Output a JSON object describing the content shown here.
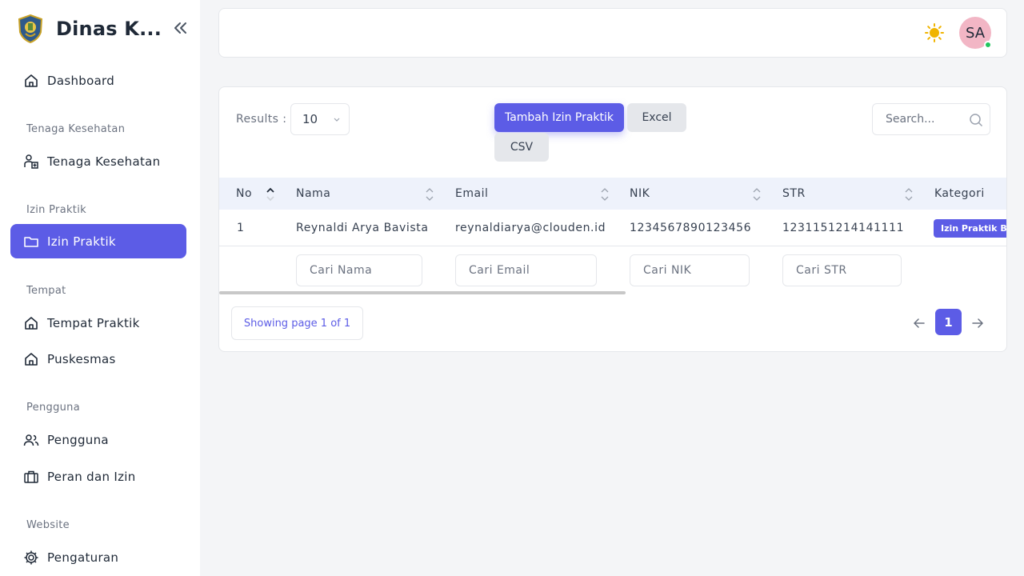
{
  "app": {
    "title": "Dinas K..."
  },
  "sidebar": {
    "sections": {
      "tenaga": "Tenaga Kesehatan",
      "izin": "Izin Praktik",
      "tempat": "Tempat",
      "pengguna": "Pengguna",
      "website": "Website"
    },
    "items": {
      "dashboard": "Dashboard",
      "tenaga": "Tenaga Kesehatan",
      "izin": "Izin Praktik",
      "tempat_praktik": "Tempat Praktik",
      "puskesmas": "Puskesmas",
      "pengguna": "Pengguna",
      "peran": "Peran dan Izin",
      "pengaturan": "Pengaturan"
    },
    "active": "Izin Praktik"
  },
  "header": {
    "avatar_initials": "SA",
    "theme_icon": "sun-icon"
  },
  "toolbar": {
    "results_label": "Results :",
    "page_size": "10",
    "add_label": "Tambah Izin Praktik",
    "excel_label": "Excel",
    "csv_label": "CSV",
    "search_placeholder": "Search..."
  },
  "table": {
    "columns": {
      "no": "No",
      "nama": "Nama",
      "email": "Email",
      "nik": "NIK",
      "str": "STR",
      "kategori": "Kategori"
    },
    "rows": [
      {
        "no": "1",
        "nama": "Reynaldi Arya Bavista",
        "email": "reynaldiarya@clouden.id",
        "nik": "1234567890123456",
        "str": "1231151214141111",
        "kategori": "Izin Praktik B"
      }
    ],
    "filters": {
      "nama": "Cari Nama",
      "email": "Cari Email",
      "nik": "Cari NIK",
      "str": "Cari STR"
    }
  },
  "pagination": {
    "info": "Showing page 1 of 1",
    "current": "1"
  },
  "colors": {
    "accent": "#5c5ce6",
    "status_online": "#22c55e",
    "avatar_bg": "#f2b6c5"
  }
}
